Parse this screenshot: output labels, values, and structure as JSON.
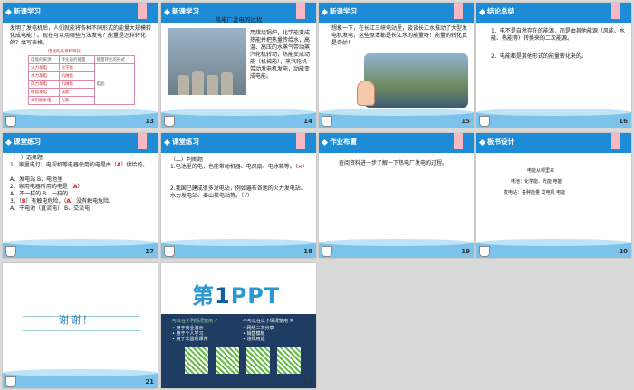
{
  "slides": [
    {
      "num": "13",
      "tag": "新课学习",
      "text": "发明了发电机后，人们就能将各种不同形式的能量大规模转化成电能了。现在可以用哪些方法发电？能量是怎样转化的？填写表格。",
      "table_title": "电能的来源和转化",
      "table_header": [
        "电能的来源",
        "转化前的能量",
        "能量转化的形式"
      ],
      "table_rows": [
        [
          "火力发电",
          "化学能"
        ],
        [
          "水力发电",
          "机械能"
        ],
        [
          "风力发电",
          "机械能"
        ],
        [
          "核能发电",
          "核能"
        ],
        [
          "太阳能发电",
          "光能"
        ]
      ],
      "table_merged": "电能"
    },
    {
      "num": "14",
      "tag": "新课学习",
      "title": "热电厂发电的过程",
      "text": "用煤烧锅炉，化学能变成热能并把热量传给水，高温、高压的水蒸气带动蒸汽轮机转动，热能变成动能（机械能），蒸汽轮机带动发电机发电，动能变成电能。"
    },
    {
      "num": "15",
      "tag": "新课学习",
      "text": "想象一下，在长江三峡电站里，谈谈长江水推动了大型发电机发电，这些原本都是长江水的能量呀！能量的转化真是奇妙！"
    },
    {
      "num": "16",
      "tag": "结论总结",
      "points": [
        "1、电不是自然存在的能源，而是由其他能源（风能、水能、热能等）转换来的二次能源。",
        "2、电能都是其他形式的能量转化来的。"
      ]
    },
    {
      "num": "17",
      "tag": "课堂练习",
      "lines": [
        "（一）选择题",
        "1、家里电灯、电视机等电器使用的电是由（ A ）供给的。",
        "A、发电站 B、电池里",
        "2、家用电器所用的电是（ A ）",
        "A、不一样的 B、一样的",
        "3、（ B ）有触电危险，（ A ）没有触电危险。",
        "A、干电池（直流电） B、交流电"
      ]
    },
    {
      "num": "18",
      "tag": "课堂练习",
      "lines": [
        "（二）判断题",
        "1.电池里的电，也能带动机器、电风扇、电冰箱等。（ × ）",
        "2.我国已建成很多发电站，例如遍布各地的火力发电站、水力发电站、秦山核电站等。（ √ ）"
      ]
    },
    {
      "num": "19",
      "tag": "作业布置",
      "text": "查阅资料进一步了解一下热电厂发电的过程。"
    },
    {
      "num": "20",
      "tag": "板书设计",
      "lines": [
        "电能从哪里来",
        "电池：化学能、光能    电能",
        "发电站：各种能量 发电机 电能"
      ]
    },
    {
      "num": "21",
      "thanks": "谢谢！"
    },
    {
      "num": "22",
      "logo_a": "第",
      "logo_b": "1",
      "logo_c": "PPT",
      "panel_left": "可以在下列情况使用 ✓",
      "panel_right": "不可以在以下情况使用 ✕",
      "left_items": [
        "• 用于商业演示",
        "• 用于个人学习",
        "• 用于非盈利课件"
      ],
      "right_items": [
        "• 网络二次分享",
        "• 销售模板",
        "• 违规用途"
      ]
    }
  ],
  "colors": {
    "header": "#1d8bd5",
    "wave": "#7cc3ec",
    "answer": "#e11111"
  }
}
